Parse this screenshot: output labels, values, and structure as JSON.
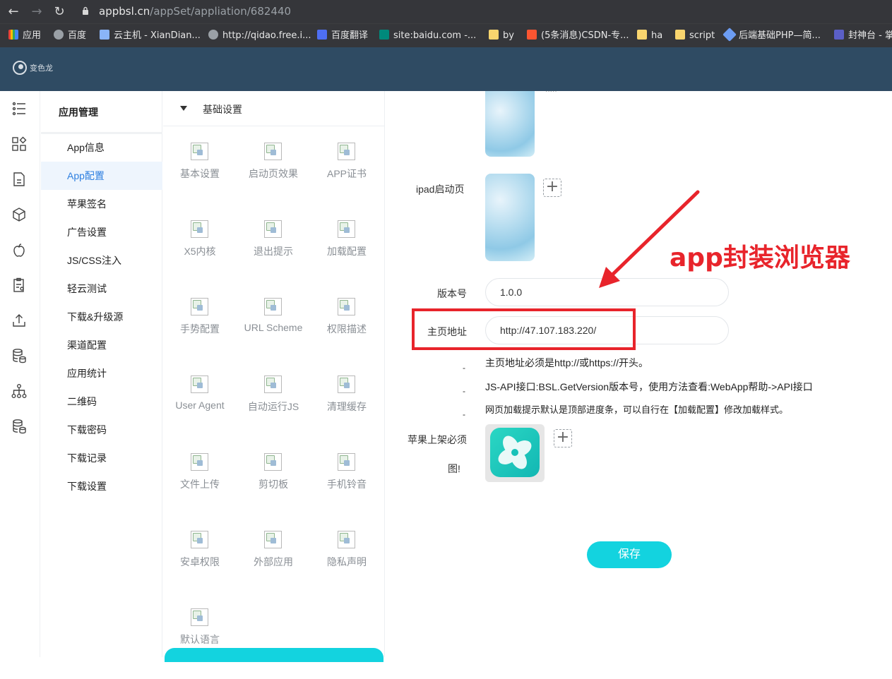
{
  "browser": {
    "url_host": "appbsl.cn",
    "url_path": "/appSet/appliation/682440",
    "bookmarks": [
      {
        "label": "应用",
        "color": "#e8710a"
      },
      {
        "label": "百度",
        "color": "#9aa0a6"
      },
      {
        "label": "云主机 - XianDian...",
        "color": "#8ab4f8"
      },
      {
        "label": "http://qidao.free.i...",
        "color": "#9aa0a6"
      },
      {
        "label": "百度翻译",
        "color": "#4e6ef2"
      },
      {
        "label": "site:baidu.com -...",
        "color": "#00897b"
      },
      {
        "label": "by",
        "color": "#f9d56e"
      },
      {
        "label": "(5条消息)CSDN-专...",
        "color": "#fc5531"
      },
      {
        "label": "ha",
        "color": "#f9d56e"
      },
      {
        "label": "script",
        "color": "#f9d56e"
      },
      {
        "label": "后端基础PHP—简...",
        "color": "#6c9cf2"
      },
      {
        "label": "封神台 - 掌",
        "color": "#5b5fc7"
      }
    ]
  },
  "app": {
    "logo_text": "变色龙"
  },
  "sidebar_icons": [
    "list-icon",
    "apps-icon",
    "document-icon",
    "cube-icon",
    "apple-icon",
    "clipboard-icon",
    "upload-icon",
    "database-icon",
    "hierarchy-icon",
    "database-icon-2"
  ],
  "menu": {
    "title": "应用管理",
    "items": [
      {
        "label": "App信息",
        "active": false
      },
      {
        "label": "App配置",
        "active": true
      },
      {
        "label": "苹果签名",
        "active": false
      },
      {
        "label": "广告设置",
        "active": false
      },
      {
        "label": "JS/CSS注入",
        "active": false
      },
      {
        "label": "轻云测试",
        "active": false
      },
      {
        "label": "下载&升级源",
        "active": false
      },
      {
        "label": "渠道配置",
        "active": false
      },
      {
        "label": "应用统计",
        "active": false
      },
      {
        "label": "二维码",
        "active": false
      },
      {
        "label": "下载密码",
        "active": false
      },
      {
        "label": "下载记录",
        "active": false
      },
      {
        "label": "下载设置",
        "active": false
      }
    ]
  },
  "settings_grid": {
    "header": "基础设置",
    "tiles": [
      "基本设置",
      "启动页效果",
      "APP证书",
      "X5内核",
      "退出提示",
      "加载配置",
      "手势配置",
      "URL Scheme",
      "权限描述",
      "User Agent",
      "自动运行JS",
      "清理缓存",
      "文件上传",
      "剪切板",
      "手机铃音",
      "安卓权限",
      "外部应用",
      "隐私声明",
      "默认语言"
    ]
  },
  "form": {
    "ipad_label": "ipad启动页",
    "version_label": "版本号",
    "version_value": "1.0.0",
    "homepage_label": "主页地址",
    "homepage_value": "http://47.107.183.220/",
    "hints": [
      "主页地址必须是http://或https://开头。",
      "JS-API接口:BSL.GetVersion版本号，使用方法查看:WebApp帮助->API接口",
      "网页加载提示默认是顶部进度条，可以自行在【加载配置】修改加载样式。"
    ],
    "apple_label_1": "苹果上架必须",
    "apple_label_2": "图!",
    "save_label": "保存"
  },
  "annotation": {
    "text": "app封装浏览器",
    "color": "#e8242b"
  }
}
